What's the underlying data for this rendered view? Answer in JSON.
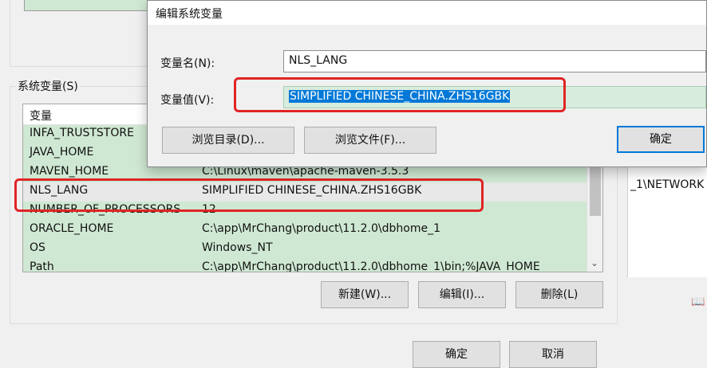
{
  "dialog": {
    "title": "编辑系统变量",
    "name_label": "变量名(N):",
    "name_value": "NLS_LANG",
    "value_label": "变量值(V):",
    "value_value": "SIMPLIFIED CHINESE_CHINA.ZHS16GBK",
    "browse_dir_label": "浏览目录(D)...",
    "browse_file_label": "浏览文件(F)...",
    "ok_label": "确定"
  },
  "system_vars": {
    "group_label": "系统变量(S)",
    "column_header": "变量",
    "rows": [
      {
        "name": "INFA_TRUSTSTORE",
        "value": ""
      },
      {
        "name": "JAVA_HOME",
        "value": ""
      },
      {
        "name": "MAVEN_HOME",
        "value": "C:\\Linux\\maven\\apache-maven-3.5.3"
      },
      {
        "name": "NLS_LANG",
        "value": "SIMPLIFIED CHINESE_CHINA.ZHS16GBK"
      },
      {
        "name": "NUMBER_OF_PROCESSORS",
        "value": "12"
      },
      {
        "name": "ORACLE_HOME",
        "value": "C:\\app\\MrChang\\product\\11.2.0\\dbhome_1"
      },
      {
        "name": "OS",
        "value": "Windows_NT"
      },
      {
        "name": "Path",
        "value": "C:\\app\\MrChang\\product\\11.2.0\\dbhome_1\\bin;%JAVA_HOME"
      }
    ],
    "new_label": "新建(W)...",
    "edit_label": "编辑(I)...",
    "delete_label": "删除(L)"
  },
  "footer": {
    "ok_label": "确定",
    "cancel_label": "取消"
  },
  "right_panel": {
    "partial_text": "_1\\NETWORK"
  },
  "icons": {
    "scroll_down": "chevron-down-icon",
    "book": "book-icon"
  },
  "colors": {
    "accent": "#0078d7",
    "row_green": "#cfe8d3",
    "annotation_red": "#e02424"
  }
}
